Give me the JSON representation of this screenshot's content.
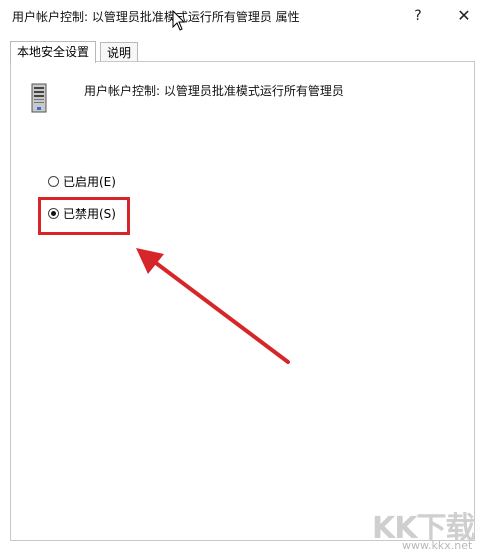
{
  "window": {
    "title": "用户帐户控制: 以管理员批准模式运行所有管理员 属性",
    "help_label": "?",
    "close_label": "✕"
  },
  "tabs": [
    {
      "label": "本地安全设置",
      "active": true
    },
    {
      "label": "说明",
      "active": false
    }
  ],
  "policy": {
    "name": "用户帐户控制: 以管理员批准模式运行所有管理员",
    "icon": "server-policy-icon"
  },
  "options": [
    {
      "label": "已启用(E)",
      "checked": false
    },
    {
      "label": "已禁用(S)",
      "checked": true
    }
  ],
  "annotation": {
    "color": "#d6262a"
  },
  "watermark": {
    "brand": "KK下载",
    "url": "www.kkx.net"
  }
}
